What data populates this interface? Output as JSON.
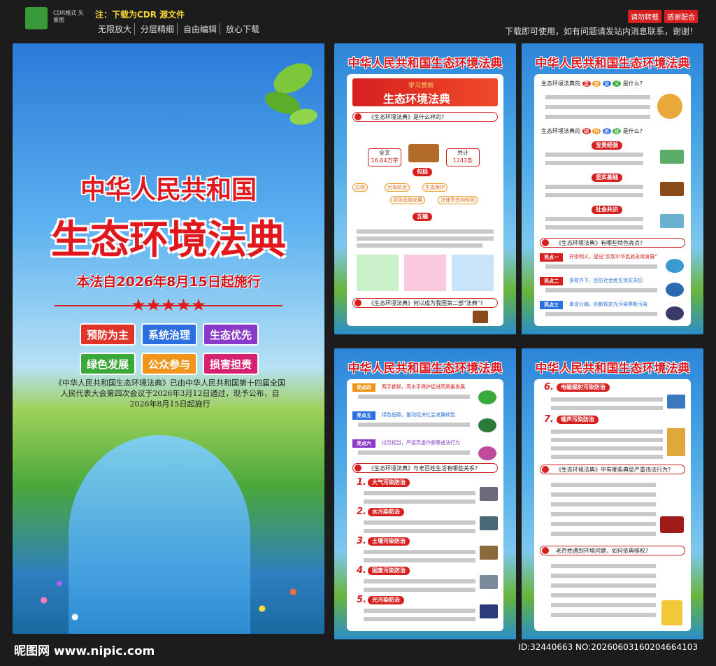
{
  "header": {
    "logo_text": "CDR格式 矢量图",
    "note_title": "注：下载为CDR 源文件",
    "features": [
      "无限放大",
      "分层精细",
      "自由编辑",
      "放心下载"
    ],
    "badges": [
      "请勿转载",
      "感谢配合"
    ],
    "notice": "下载即可使用，如有问题请发站内消息联系，谢谢！"
  },
  "main_poster": {
    "title_line1": "中华人民共和国",
    "title_line2": "生态环境法典",
    "effective": "本法自2026年8月15日起施行",
    "stars": "★★★★★",
    "tags": [
      {
        "label": "预防为主",
        "color": "#e0342b"
      },
      {
        "label": "系统治理",
        "color": "#2a6ee0"
      },
      {
        "label": "生态优先",
        "color": "#8a3ac8"
      },
      {
        "label": "绿色发展",
        "color": "#3aa83a"
      },
      {
        "label": "公众参与",
        "color": "#f0951a"
      },
      {
        "label": "损害担责",
        "color": "#d62070"
      }
    ],
    "description": "《中华人民共和国生态环境法典》已由中华人民共和国第十四届全国人民代表大会第四次会议于2026年3月12日通过，现予公布，自2026年8月15日起施行"
  },
  "side_title": "中华人民共和国生态环境法典",
  "panel1": {
    "banner_small": "学习贯彻",
    "banner_big": "生态环境法典",
    "q1": "《生态环境法典》是什么样的?",
    "total_label": "全文",
    "total_value": "16.64万字",
    "count_label": "共计",
    "count_value": "1242条",
    "include": "包括",
    "parts": [
      "总则",
      "污染防治",
      "生态保护",
      "绿色低碳发展",
      "法律责任和附则"
    ],
    "five": "五编",
    "q2": "《生态环境法典》何以成为我国第二部\"法典\"?"
  },
  "panel2": {
    "q1": "生态环境法典的",
    "q1_chars": [
      "重",
      "要",
      "意",
      "义"
    ],
    "q1_end": "是什么?",
    "q2": "生态环境法典的",
    "q2_chars": [
      "编",
      "撰",
      "基",
      "础"
    ],
    "q2_end": "是什么?",
    "labels": [
      "宝贵经验",
      "坚实基础",
      "社会共识"
    ],
    "q3": "《生态环境法典》有哪些特色亮点?",
    "highlights": [
      {
        "tag": "亮点一",
        "text": "开宗明义，提出\"实现中华民族永续发展\""
      },
      {
        "tag": "亮点二",
        "text": "多管齐下，回应社会民生现实关切"
      },
      {
        "tag": "亮点三",
        "text": "单设分编，创新规定光污染等新污染"
      }
    ]
  },
  "panel3": {
    "highlights": [
      {
        "tag": "亮点四",
        "text": "两手都抓，高水平保护促进高质量发展"
      },
      {
        "tag": "亮点五",
        "text": "绿色低碳，推动经济社会发展转型"
      },
      {
        "tag": "亮点六",
        "text": "过罚相当，严惩弄虚作假等违法行为"
      }
    ],
    "q": "《生态环境法典》与老百姓生活有哪些关系?",
    "items": [
      {
        "num": "1.",
        "label": "大气污染防治"
      },
      {
        "num": "2.",
        "label": "水污染防治"
      },
      {
        "num": "3.",
        "label": "土壤污染防治"
      },
      {
        "num": "4.",
        "label": "固废污染防治"
      },
      {
        "num": "5.",
        "label": "光污染防治"
      }
    ]
  },
  "panel4": {
    "items": [
      {
        "num": "6.",
        "label": "电磁辐射污染防治"
      },
      {
        "num": "7.",
        "label": "噪声污染防治"
      }
    ],
    "q1": "《生态环境法典》中有哪些典型严重违法行为?",
    "q2": "老百姓遇到环境问题，如何依典维权?"
  },
  "footer": {
    "site": "昵图网 www.nipic.com",
    "id": "ID:32440663 NO:20260603160204664103"
  }
}
